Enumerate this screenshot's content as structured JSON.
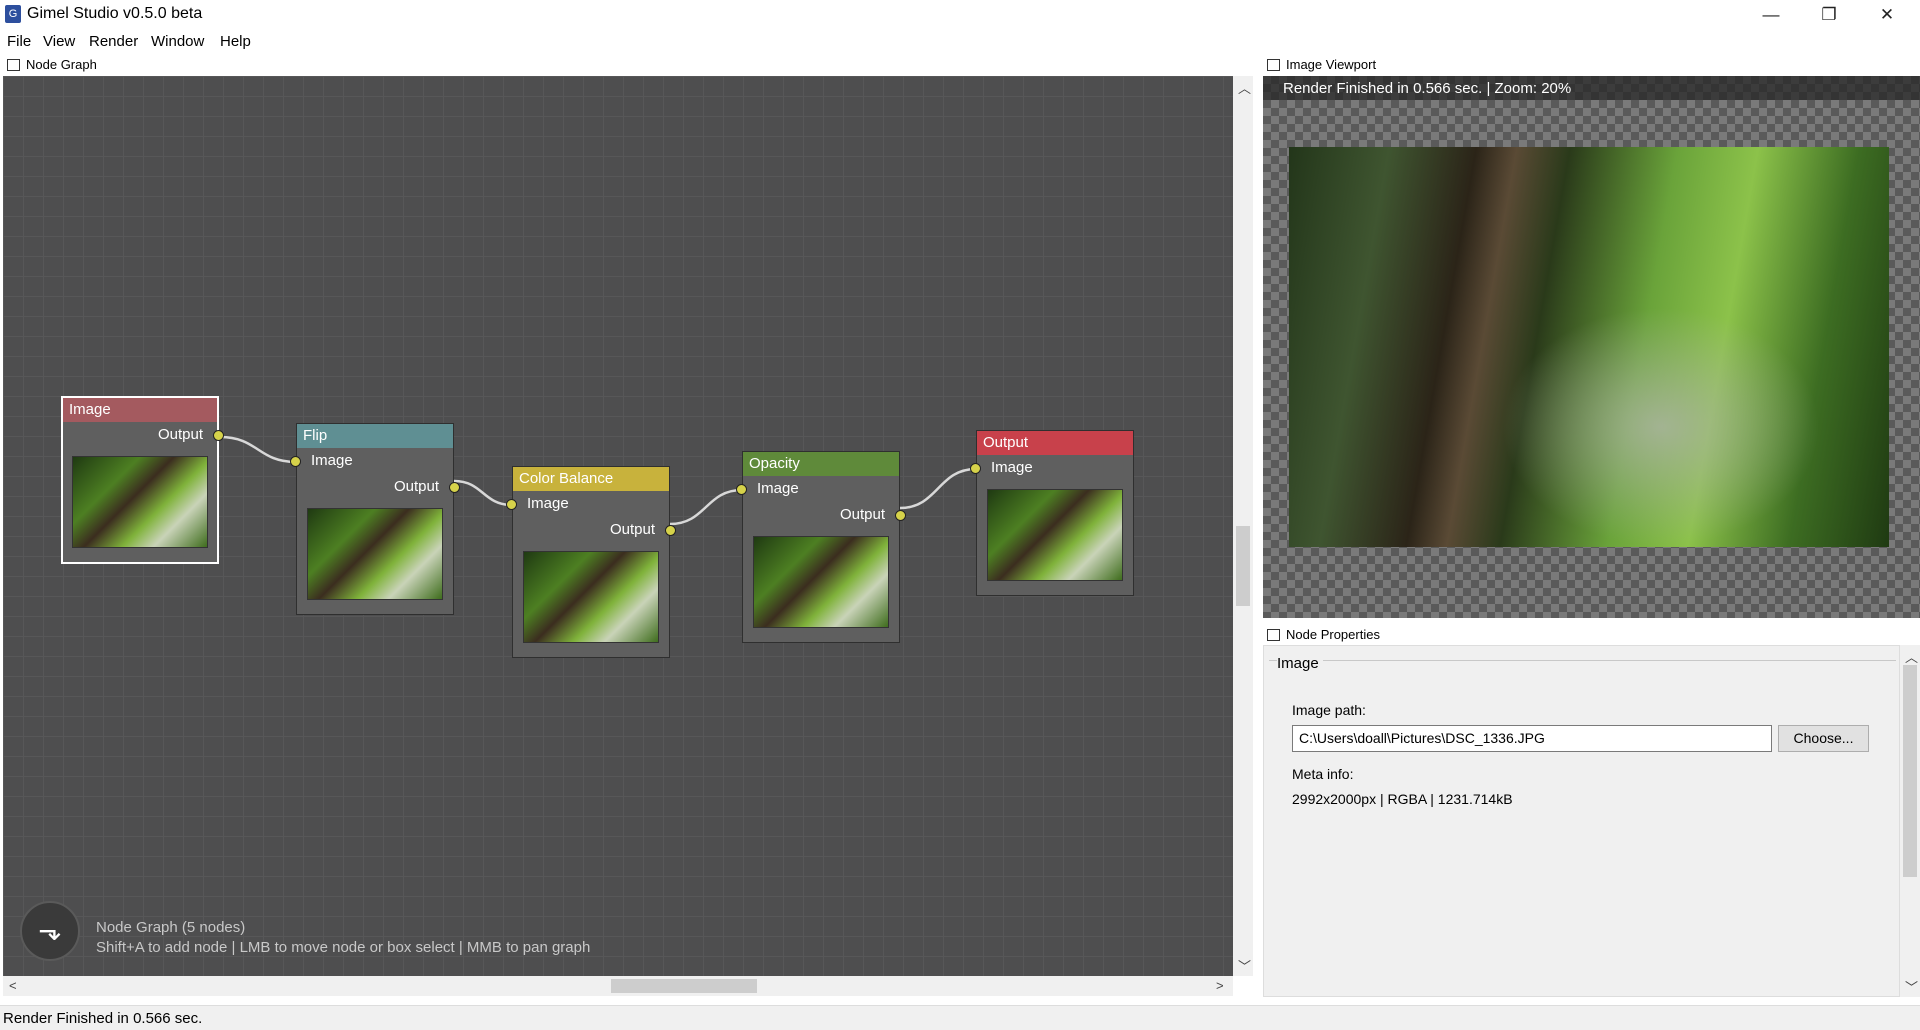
{
  "window": {
    "title": "Gimel Studio v0.5.0 beta",
    "minimize": "—",
    "maximize": "❐",
    "close": "✕"
  },
  "menu": [
    "File",
    "View",
    "Render",
    "Window",
    "Help"
  ],
  "node_graph": {
    "caption": "Node Graph",
    "info_title": "Node Graph (5 nodes)",
    "info_hint": "Shift+A to add node | LMB to move node or box select | MMB to pan graph",
    "nodes": [
      {
        "title": "Image",
        "color": "#a45a5f",
        "outputs": [
          "Output"
        ],
        "inputs": []
      },
      {
        "title": "Flip",
        "color": "#5f8f93",
        "inputs": [
          "Image"
        ],
        "outputs": [
          "Output"
        ]
      },
      {
        "title": "Color Balance",
        "color": "#c8b23c",
        "inputs": [
          "Image"
        ],
        "outputs": [
          "Output"
        ]
      },
      {
        "title": "Opacity",
        "color": "#5f8a3a",
        "inputs": [
          "Image"
        ],
        "outputs": [
          "Output"
        ]
      },
      {
        "title": "Output",
        "color": "#c8414b",
        "inputs": [
          "Image"
        ],
        "outputs": []
      }
    ]
  },
  "viewport": {
    "caption": "Image Viewport",
    "status": "Render Finished in 0.566 sec. | Zoom: 20%"
  },
  "properties": {
    "caption": "Node Properties",
    "group": "Image",
    "path_label": "Image path:",
    "path_value": "C:\\Users\\doall\\Pictures\\DSC_1336.JPG",
    "choose_label": "Choose...",
    "meta_label": "Meta info:",
    "meta_value": "2992x2000px | RGBA | 1231.714kB"
  },
  "statusbar": {
    "text": "Render Finished in 0.566 sec."
  }
}
